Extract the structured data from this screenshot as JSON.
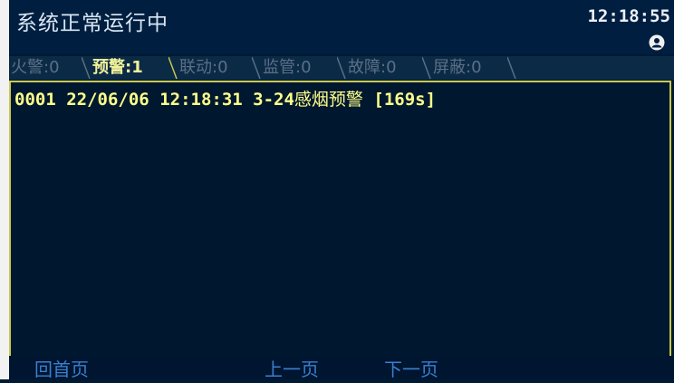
{
  "header": {
    "status_text": "系统正常运行中",
    "clock": "12:18:55",
    "user_icon": "user-icon"
  },
  "tabs": [
    {
      "label": "火警:0",
      "active": false
    },
    {
      "label": "预警:1",
      "active": true
    },
    {
      "label": "联动:0",
      "active": false
    },
    {
      "label": "监管:0",
      "active": false
    },
    {
      "label": "故障:0",
      "active": false
    },
    {
      "label": "屏蔽:0",
      "active": false
    }
  ],
  "alarms": [
    {
      "id": "0001",
      "date": "22/06/06",
      "time": "12:18:31",
      "location": "3-24",
      "description": "感烟预警",
      "duration": "[169s]"
    }
  ],
  "footer": {
    "home_label": "回首页",
    "prev_label": "上一页",
    "next_label": "下一页"
  },
  "colors": {
    "background": "#001a33",
    "tab_active": "#f1f19a",
    "tab_inactive": "#5b6f86",
    "alarm_text": "#ffff8a",
    "tab_border": "#c9c950",
    "footer_button": "#3a7fcf"
  }
}
